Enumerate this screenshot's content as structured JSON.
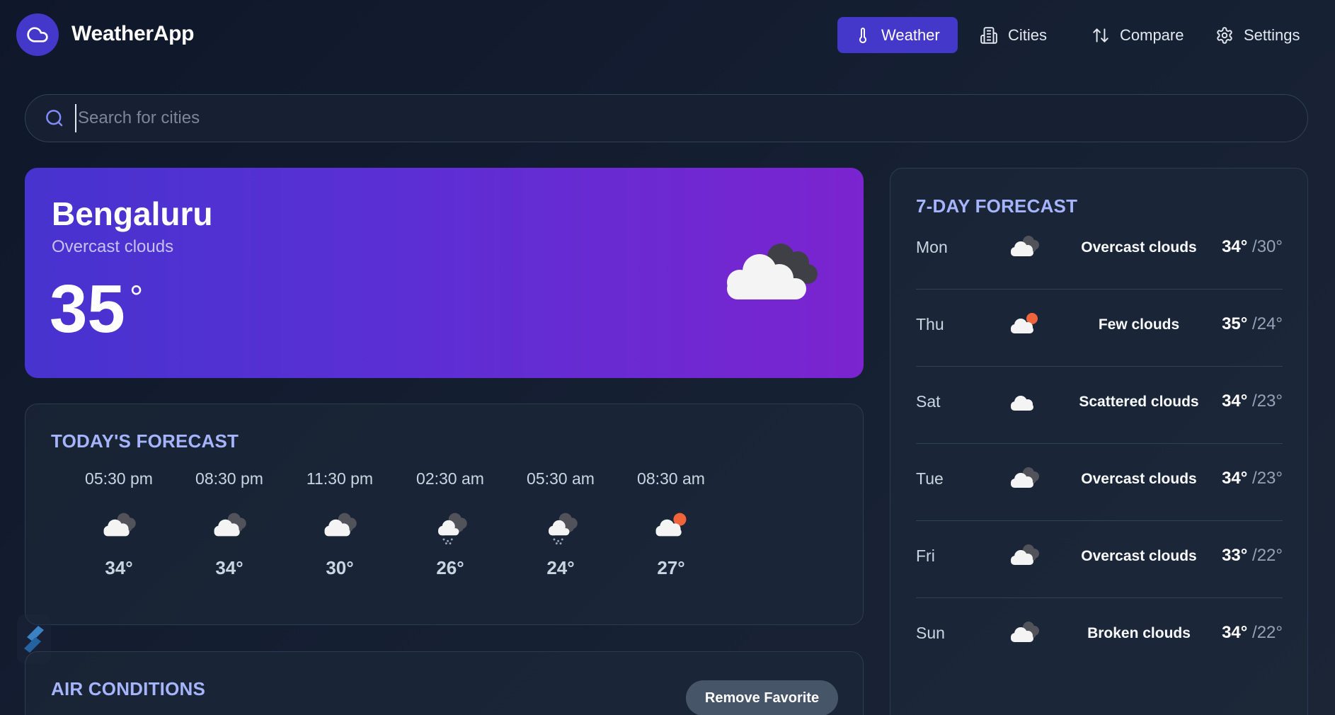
{
  "app": {
    "name": "WeatherApp"
  },
  "nav": {
    "items": [
      {
        "label": "Weather",
        "icon": "thermometer-icon",
        "active": true
      },
      {
        "label": "Cities",
        "icon": "building-icon",
        "active": false
      },
      {
        "label": "Compare",
        "icon": "arrows-up-down-icon",
        "active": false
      },
      {
        "label": "Settings",
        "icon": "gear-icon",
        "active": false
      }
    ]
  },
  "search": {
    "placeholder": "Search for cities",
    "value": ""
  },
  "current": {
    "city": "Bengaluru",
    "description": "Overcast clouds",
    "temperature": "35",
    "degree_symbol": "°",
    "icon": "overcast-clouds-icon"
  },
  "today": {
    "title": "TODAY'S FORECAST",
    "hours": [
      {
        "time": "05:30 pm",
        "temp": "34°",
        "icon": "overcast-clouds-icon"
      },
      {
        "time": "08:30 pm",
        "temp": "34°",
        "icon": "overcast-clouds-icon"
      },
      {
        "time": "11:30 pm",
        "temp": "30°",
        "icon": "overcast-clouds-icon"
      },
      {
        "time": "02:30 am",
        "temp": "26°",
        "icon": "rain-cloud-icon"
      },
      {
        "time": "05:30 am",
        "temp": "24°",
        "icon": "rain-cloud-icon"
      },
      {
        "time": "08:30 am",
        "temp": "27°",
        "icon": "few-clouds-sun-icon"
      }
    ]
  },
  "air": {
    "title": "AIR CONDITIONS",
    "remove_favorite_label": "Remove Favorite"
  },
  "week": {
    "title": "7-DAY FORECAST",
    "days": [
      {
        "day": "Mon",
        "condition": "Overcast clouds",
        "high": "34°",
        "low": "/30°",
        "icon": "overcast-clouds-icon"
      },
      {
        "day": "Thu",
        "condition": "Few clouds",
        "high": "35°",
        "low": "/24°",
        "icon": "few-clouds-sun-icon"
      },
      {
        "day": "Sat",
        "condition": "Scattered clouds",
        "high": "34°",
        "low": "/23°",
        "icon": "scattered-clouds-icon"
      },
      {
        "day": "Tue",
        "condition": "Overcast clouds",
        "high": "34°",
        "low": "/23°",
        "icon": "overcast-clouds-icon"
      },
      {
        "day": "Fri",
        "condition": "Overcast clouds",
        "high": "33°",
        "low": "/22°",
        "icon": "overcast-clouds-icon"
      },
      {
        "day": "Sun",
        "condition": "Broken clouds",
        "high": "34°",
        "low": "/22°",
        "icon": "broken-clouds-icon"
      }
    ]
  },
  "colors": {
    "accent": "#4338ca",
    "section_title": "#a5b4fc",
    "hero_gradient_start": "#4733cf",
    "hero_gradient_end": "#7b24d0",
    "sun": "#f0643c"
  }
}
